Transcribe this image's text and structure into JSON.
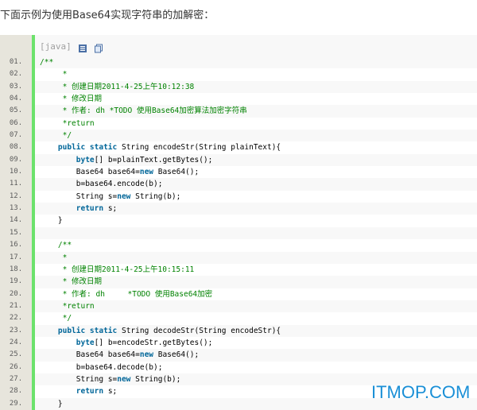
{
  "intro_text": "下面示例为使用Base64实现字符串的加解密：",
  "toolbar": {
    "lang_label": "[java]"
  },
  "watermark": "ITMOP.COM",
  "colors": {
    "gutter": "#e7e5dc",
    "accent_bar": "#6ce26c",
    "comment": "#008200",
    "keyword": "#006699"
  },
  "code_lines": [
    {
      "num": "01.",
      "parts": [
        {
          "t": "/**",
          "s": "c"
        }
      ]
    },
    {
      "num": "02.",
      "parts": [
        {
          "t": "     *",
          "s": "c"
        }
      ]
    },
    {
      "num": "03.",
      "parts": [
        {
          "t": "     * 创建日期2011-4-25上午10:12:38",
          "s": "c"
        }
      ]
    },
    {
      "num": "04.",
      "parts": [
        {
          "t": "     * 修改日期",
          "s": "c"
        }
      ]
    },
    {
      "num": "05.",
      "parts": [
        {
          "t": "     * 作者: dh *TODO 使用Base64加密算法加密字符串",
          "s": "c"
        }
      ]
    },
    {
      "num": "06.",
      "parts": [
        {
          "t": "     *return",
          "s": "c"
        }
      ]
    },
    {
      "num": "07.",
      "parts": [
        {
          "t": "     */",
          "s": "c"
        }
      ]
    },
    {
      "num": "08.",
      "parts": [
        {
          "t": "    ",
          "s": ""
        },
        {
          "t": "public static",
          "s": "k"
        },
        {
          "t": " String encodeStr(String plainText){",
          "s": ""
        }
      ]
    },
    {
      "num": "09.",
      "parts": [
        {
          "t": "        ",
          "s": ""
        },
        {
          "t": "byte",
          "s": "k"
        },
        {
          "t": "[] b=plainText.getBytes();",
          "s": ""
        }
      ]
    },
    {
      "num": "10.",
      "parts": [
        {
          "t": "        Base64 base64=",
          "s": ""
        },
        {
          "t": "new",
          "s": "k"
        },
        {
          "t": " Base64();",
          "s": ""
        }
      ]
    },
    {
      "num": "11.",
      "parts": [
        {
          "t": "        b=base64.encode(b);",
          "s": ""
        }
      ]
    },
    {
      "num": "12.",
      "parts": [
        {
          "t": "        String s=",
          "s": ""
        },
        {
          "t": "new",
          "s": "k"
        },
        {
          "t": " String(b);",
          "s": ""
        }
      ]
    },
    {
      "num": "13.",
      "parts": [
        {
          "t": "        ",
          "s": ""
        },
        {
          "t": "return",
          "s": "k"
        },
        {
          "t": " s;",
          "s": ""
        }
      ]
    },
    {
      "num": "14.",
      "parts": [
        {
          "t": "    }",
          "s": ""
        }
      ]
    },
    {
      "num": "15.",
      "parts": [
        {
          "t": "",
          "s": ""
        }
      ]
    },
    {
      "num": "16.",
      "parts": [
        {
          "t": "    /**",
          "s": "c"
        }
      ]
    },
    {
      "num": "17.",
      "parts": [
        {
          "t": "     *",
          "s": "c"
        }
      ]
    },
    {
      "num": "18.",
      "parts": [
        {
          "t": "     * 创建日期2011-4-25上午10:15:11",
          "s": "c"
        }
      ]
    },
    {
      "num": "19.",
      "parts": [
        {
          "t": "     * 修改日期",
          "s": "c"
        }
      ]
    },
    {
      "num": "20.",
      "parts": [
        {
          "t": "     * 作者: dh     *TODO 使用Base64加密",
          "s": "c"
        }
      ]
    },
    {
      "num": "21.",
      "parts": [
        {
          "t": "     *return",
          "s": "c"
        }
      ]
    },
    {
      "num": "22.",
      "parts": [
        {
          "t": "     */",
          "s": "c"
        }
      ]
    },
    {
      "num": "23.",
      "parts": [
        {
          "t": "    ",
          "s": ""
        },
        {
          "t": "public static",
          "s": "k"
        },
        {
          "t": " String decodeStr(String encodeStr){",
          "s": ""
        }
      ]
    },
    {
      "num": "24.",
      "parts": [
        {
          "t": "        ",
          "s": ""
        },
        {
          "t": "byte",
          "s": "k"
        },
        {
          "t": "[] b=encodeStr.getBytes();",
          "s": ""
        }
      ]
    },
    {
      "num": "25.",
      "parts": [
        {
          "t": "        Base64 base64=",
          "s": ""
        },
        {
          "t": "new",
          "s": "k"
        },
        {
          "t": " Base64();",
          "s": ""
        }
      ]
    },
    {
      "num": "26.",
      "parts": [
        {
          "t": "        b=base64.decode(b);",
          "s": ""
        }
      ]
    },
    {
      "num": "27.",
      "parts": [
        {
          "t": "        String s=",
          "s": ""
        },
        {
          "t": "new",
          "s": "k"
        },
        {
          "t": " String(b);",
          "s": ""
        }
      ]
    },
    {
      "num": "28.",
      "parts": [
        {
          "t": "        ",
          "s": ""
        },
        {
          "t": "return",
          "s": "k"
        },
        {
          "t": " s;",
          "s": ""
        }
      ]
    },
    {
      "num": "29.",
      "parts": [
        {
          "t": "    }",
          "s": ""
        }
      ]
    }
  ]
}
